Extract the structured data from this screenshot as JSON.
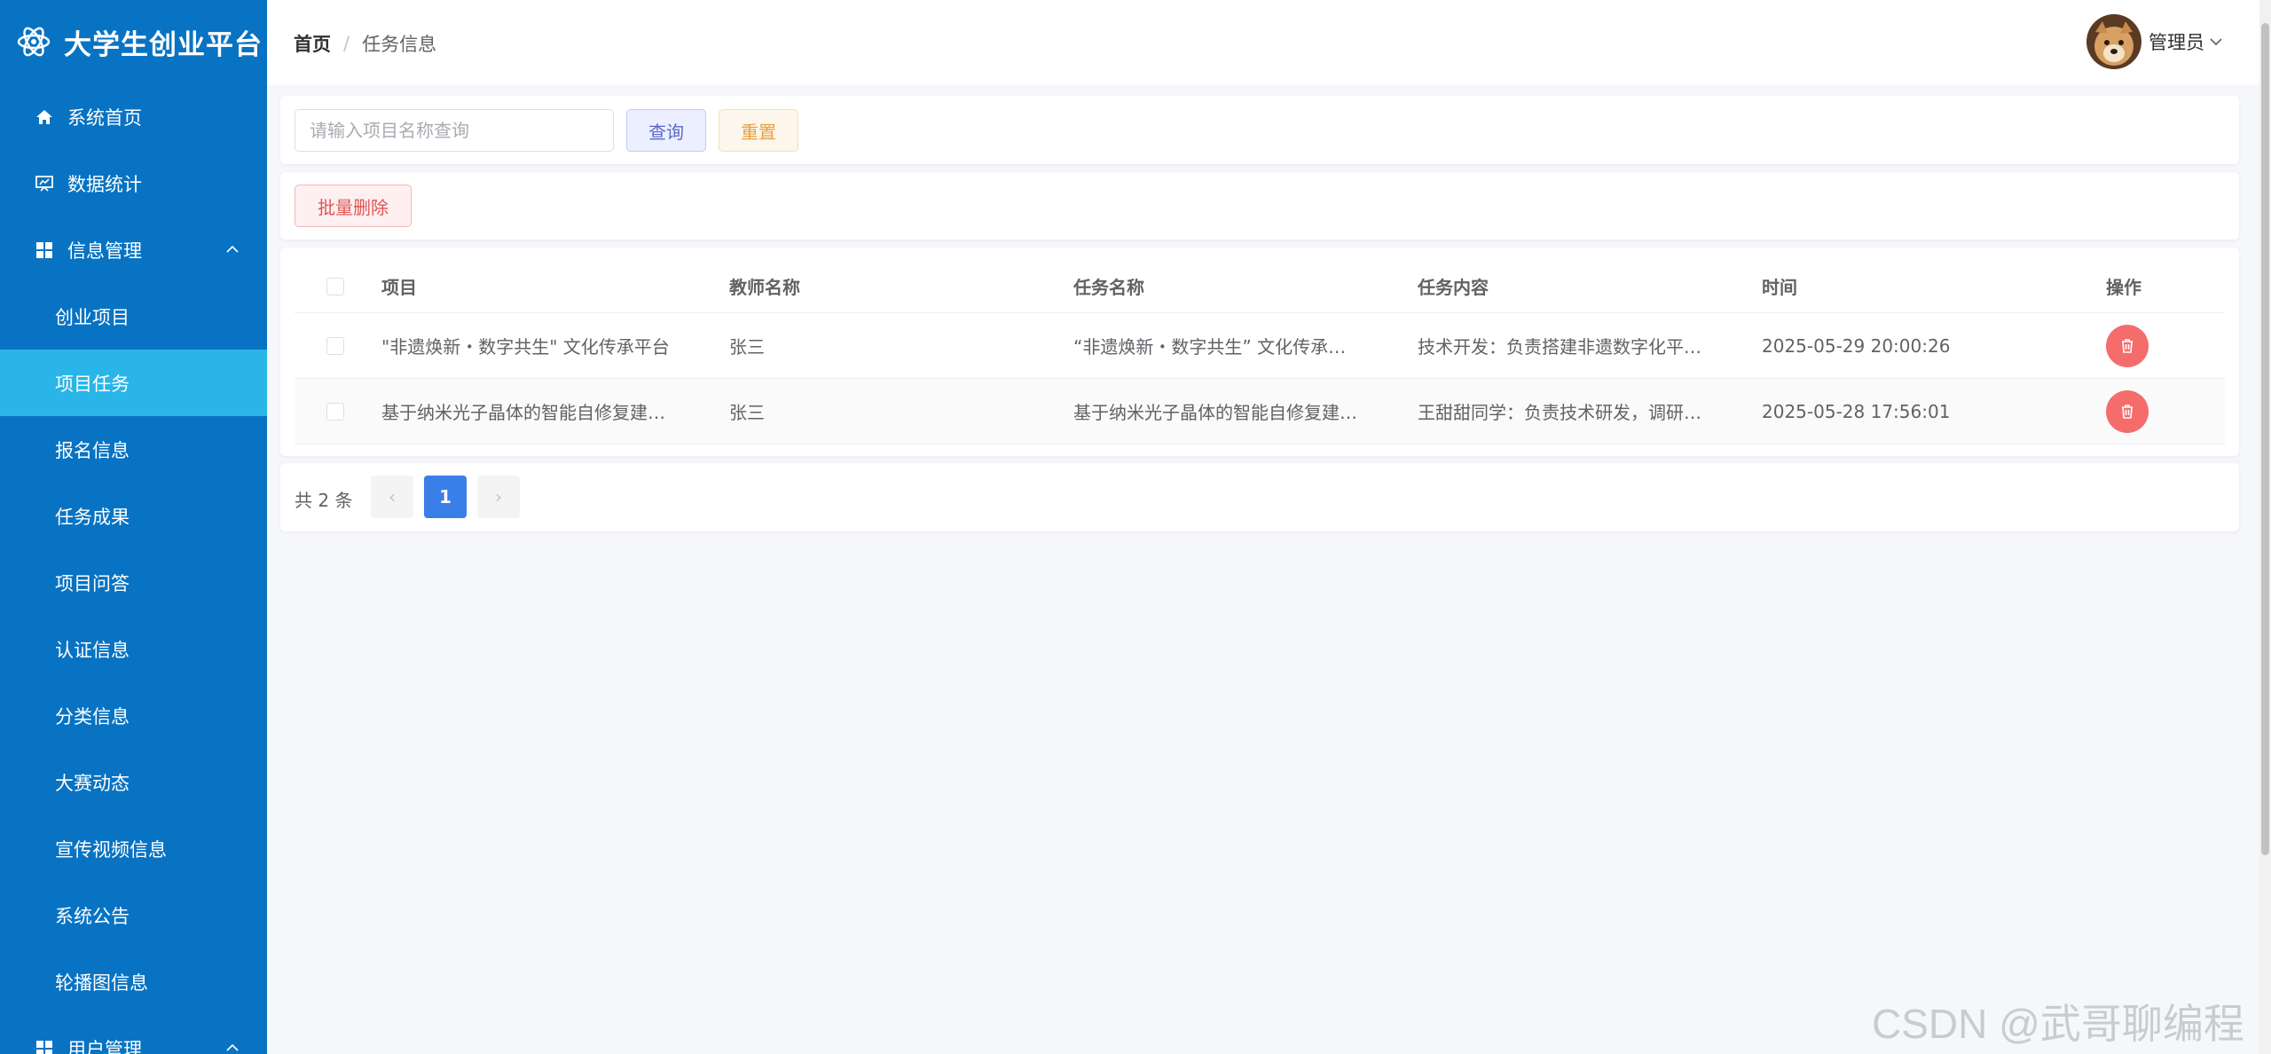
{
  "brand": {
    "title": "大学生创业平台",
    "icon": "atom-icon"
  },
  "sidebar": {
    "items": [
      {
        "label": "系统首页",
        "icon": "home-icon"
      },
      {
        "label": "数据统计",
        "icon": "chart-icon"
      },
      {
        "label": "信息管理",
        "icon": "grid-icon"
      },
      {
        "label": "用户管理",
        "icon": "grid-icon"
      }
    ],
    "sub_items": [
      {
        "label": "创业项目"
      },
      {
        "label": "项目任务"
      },
      {
        "label": "报名信息"
      },
      {
        "label": "任务成果"
      },
      {
        "label": "项目问答"
      },
      {
        "label": "认证信息"
      },
      {
        "label": "分类信息"
      },
      {
        "label": "大赛动态"
      },
      {
        "label": "宣传视频信息"
      },
      {
        "label": "系统公告"
      },
      {
        "label": "轮播图信息"
      }
    ],
    "active": "项目任务"
  },
  "header": {
    "breadcrumb_home": "首页",
    "breadcrumb_sep": "/",
    "breadcrumb_current": "任务信息",
    "user_name": "管理员"
  },
  "search": {
    "placeholder": "请输入项目名称查询",
    "query_label": "查询",
    "reset_label": "重置"
  },
  "ops": {
    "batch_delete_label": "批量删除"
  },
  "table": {
    "columns": [
      "项目",
      "教师名称",
      "任务名称",
      "任务内容",
      "时间",
      "操作"
    ],
    "rows": [
      {
        "project": "\"非遗焕新・数字共生\" 文化传承平台",
        "teacher": "张三",
        "task_name": "“非遗焕新・数字共生” 文化传承…",
        "task_content": "技术开发：负责搭建非遗数字化平…",
        "time": "2025-05-29 20:00:26"
      },
      {
        "project": "基于纳米光子晶体的智能自修复建…",
        "teacher": "张三",
        "task_name": "基于纳米光子晶体的智能自修复建…",
        "task_content": "王甜甜同学：负责技术研发，调研…",
        "time": "2025-05-28 17:56:01"
      }
    ]
  },
  "pager": {
    "total_text": "共 2 条",
    "current_page": "1",
    "prev": "‹",
    "next": "›"
  },
  "watermark": "CSDN @武哥聊编程",
  "colors": {
    "sidebar_bg": "#0873c3",
    "active_bg": "#29b5e8",
    "primary": "#3a7ee8",
    "danger": "#f56c6c"
  }
}
